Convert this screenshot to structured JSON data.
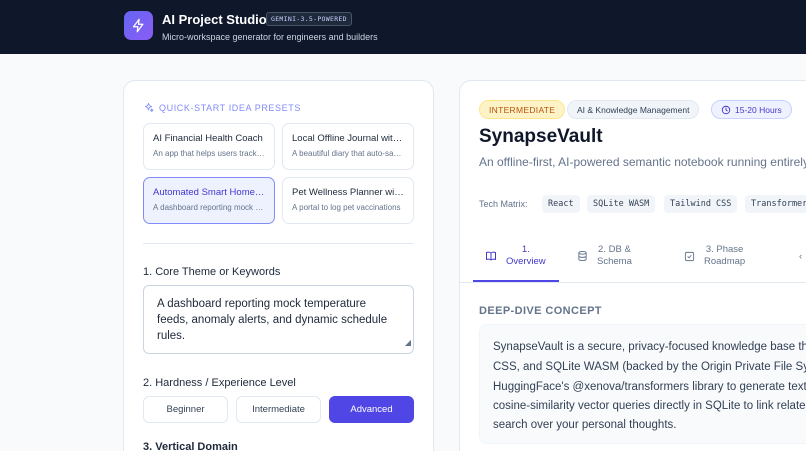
{
  "header": {
    "title": "AI Project Studio",
    "badge": "GEMINI-3.5-POWERED",
    "subtitle": "Micro-workspace generator for engineers and builders"
  },
  "presets": {
    "title": "QUICK-START IDEA PRESETS",
    "items": [
      {
        "title": "AI Financial Health Coach",
        "desc": "An app that helps users track their spending"
      },
      {
        "title": "Local Offline Journal with AI",
        "desc": "A beautiful diary that auto-saves locally"
      },
      {
        "title": "Automated Smart Home Hub",
        "desc": "A dashboard reporting mock temperature feeds"
      },
      {
        "title": "Pet Wellness Planner with AI",
        "desc": "A portal to log pet vaccinations"
      }
    ]
  },
  "form": {
    "theme_label": "1. Core Theme or Keywords",
    "theme_value": "A dashboard reporting mock temperature feeds, anomaly alerts, and dynamic schedule rules.",
    "level_label": "2. Hardness / Experience Level",
    "levels": [
      "Beginner",
      "Intermediate",
      "Advanced"
    ],
    "selected_level": "Advanced",
    "domain_label": "3. Vertical Domain"
  },
  "project": {
    "level_badge": "INTERMEDIATE",
    "domain_badge": "AI & Knowledge Management",
    "time_badge": "15-20 Hours",
    "title": "SynapseVault",
    "tagline": "An offline-first, AI-powered semantic notebook running entirely in",
    "tech_label": "Tech Matrix:",
    "tech": [
      "React",
      "SQLite WASM",
      "Tailwind CSS",
      "Transformers"
    ]
  },
  "tabs": [
    {
      "line1": "1.",
      "line2": "Overview"
    },
    {
      "line1": "2. DB &",
      "line2": "Schema"
    },
    {
      "line1": "3. Phase",
      "line2": "Roadmap"
    }
  ],
  "concept": {
    "title": "DEEP-DIVE CONCEPT",
    "lines": [
      "SynapseVault is a secure, privacy-focused knowledge base that",
      "CSS, and SQLite WASM (backed by the Origin Private File System",
      "HuggingFace's @xenova/transformers library to generate text e",
      "cosine-similarity vector queries directly in SQLite to link related",
      "search over your personal thoughts."
    ]
  },
  "colors": {
    "header_bg": "#0f172a",
    "accent": "#4f46e5",
    "accent_light": "#eef2ff",
    "badge_amber": "#b45309"
  },
  "icons": {
    "logo": "lightning-icon",
    "presets": "sparkles-icon",
    "time": "clock-icon",
    "tab1": "book-icon",
    "tab2": "database-icon",
    "tab3": "checkbox-icon"
  }
}
